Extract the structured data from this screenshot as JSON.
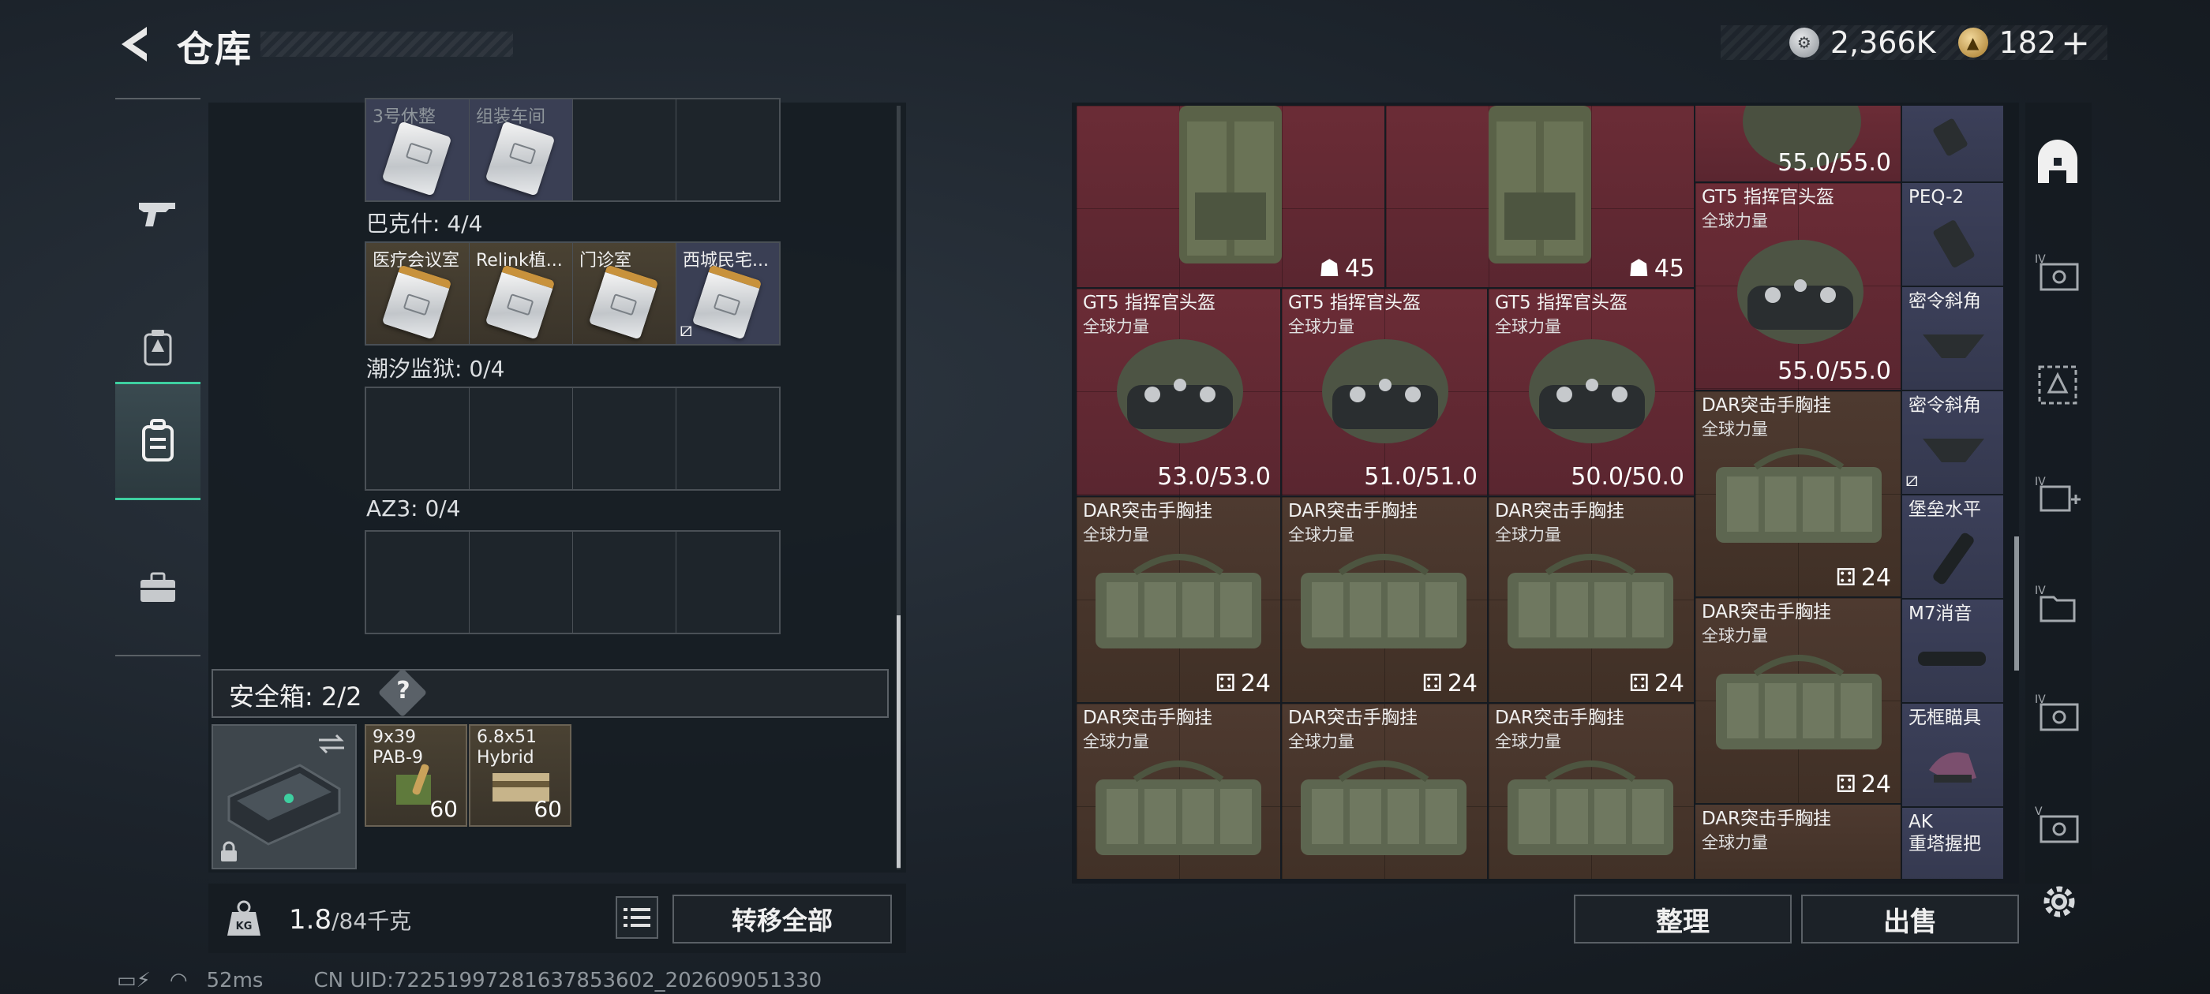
{
  "header": {
    "title": "仓库",
    "currency": [
      {
        "icon": "silver-coin-icon",
        "value": "2,366K"
      },
      {
        "icon": "gold-coin-icon",
        "value": "182"
      }
    ],
    "plus": "+"
  },
  "nav": [
    {
      "icon": "gun-icon",
      "active": false
    },
    {
      "icon": "backpack-upgrade-icon",
      "active": false
    },
    {
      "icon": "backpack-icon",
      "active": true
    },
    {
      "icon": "toolbox-icon",
      "active": false
    }
  ],
  "storage": {
    "containers": [
      {
        "label": "",
        "cells": [
          "3号休整",
          "组装车间",
          "",
          ""
        ]
      },
      {
        "label": "巴克什: 4/4",
        "cells": [
          "医疗会议室",
          "Relink植...",
          "门诊室",
          "西城民宅..."
        ]
      },
      {
        "label": "潮汐监狱: 0/4",
        "cells": [
          "",
          "",
          "",
          ""
        ]
      },
      {
        "label": "AZ3: 0/4",
        "cells": [
          "",
          "",
          "",
          ""
        ]
      }
    ],
    "safe_box": {
      "label": "安全箱: 2/2",
      "help": "?",
      "ammo": [
        {
          "name": "9x39\nPAB-9",
          "count": "60"
        },
        {
          "name": "6.8x51\nHybrid",
          "count": "60"
        }
      ]
    },
    "weight": {
      "current": "1.8",
      "capacity": "/84千克"
    },
    "transfer_all": "转移全部"
  },
  "status_bar": {
    "ping": "52ms",
    "uid": "CN UID:72251997281637853602_202609051330"
  },
  "grid_items": {
    "vest_top_1": {
      "count": "45"
    },
    "vest_top_2": {
      "count": "45"
    },
    "helmet_top": {
      "value": "55.0/55.0"
    },
    "helmet_right": {
      "name": "GT5 指挥官头盔",
      "sub": "全球力量",
      "value": "55.0/55.0"
    },
    "helmet_1": {
      "name": "GT5 指挥官头盔",
      "sub": "全球力量",
      "value": "53.0/53.0"
    },
    "helmet_2": {
      "name": "GT5 指挥官头盔",
      "sub": "全球力量",
      "value": "51.0/51.0"
    },
    "helmet_3": {
      "name": "GT5 指挥官头盔",
      "sub": "全球力量",
      "value": "50.0/50.0"
    },
    "rig_r1": {
      "name": "DAR突击手胸挂",
      "sub": "全球力量",
      "count": "24"
    },
    "rig_a1": {
      "name": "DAR突击手胸挂",
      "sub": "全球力量",
      "count": "24"
    },
    "rig_a2": {
      "name": "DAR突击手胸挂",
      "sub": "全球力量",
      "count": "24"
    },
    "rig_a3": {
      "name": "DAR突击手胸挂",
      "sub": "全球力量",
      "count": "24"
    },
    "rig_r2": {
      "name": "DAR突击手胸挂",
      "sub": "全球力量",
      "count": "24"
    },
    "rig_b1": {
      "name": "DAR突击手胸挂",
      "sub": "全球力量"
    },
    "rig_b2": {
      "name": "DAR突击手胸挂",
      "sub": "全球力量"
    },
    "rig_b3": {
      "name": "DAR突击手胸挂",
      "sub": "全球力量"
    },
    "rig_r3": {
      "name": "DAR突击手胸挂",
      "sub": "全球力量"
    },
    "att_peq": {
      "name": "PEQ-2"
    },
    "att_grip1": {
      "name": "密令斜角"
    },
    "att_grip2": {
      "name": "密令斜角"
    },
    "att_comp": {
      "name": "堡垒水平"
    },
    "att_m7": {
      "name": "M7消音"
    },
    "att_sight": {
      "name": "无框瞄具"
    },
    "att_ak": {
      "name": "AK\n重塔握把"
    }
  },
  "buttons": {
    "sort": "整理",
    "sell": "出售"
  },
  "tools": [
    "loadout-icon",
    "weapon-case-iv-icon",
    "keycard-case-icon",
    "medkit-iv-icon",
    "folder-iv-icon",
    "weapon-case-iv-2-icon",
    "weapon-case-v-icon"
  ]
}
